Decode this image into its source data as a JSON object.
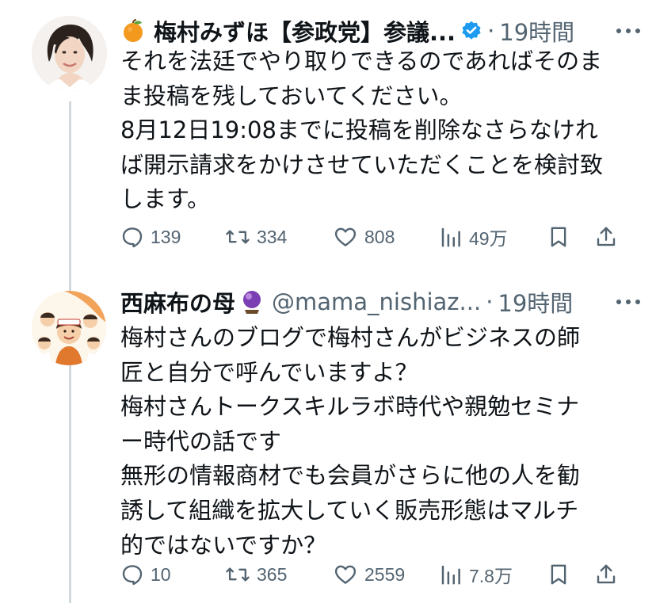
{
  "tweets": [
    {
      "display_name": "梅村みずほ【参政党】参議...",
      "handle": "",
      "time": "19時間",
      "lines": [
        "それを法廷でやり取りできるのであればそのま",
        "ま投稿を残しておいてください。",
        "8月12日19:08までに投稿を削除なさらなけれ",
        "ば開示請求をかけさせていただくことを検討致",
        "します。"
      ],
      "replies": "139",
      "reposts": "334",
      "likes": "808",
      "views": "49万"
    },
    {
      "display_name": "西麻布の母",
      "handle": "@mama_nishiaz...",
      "time": "19時間",
      "lines": [
        "梅村さんのブログで梅村さんがビジネスの師",
        "匠と自分で呼んでいますよ？",
        "梅村さんトークスキルラボ時代や親勉セミナ",
        "ー時代の話です",
        "無形の情報商材でも会員がさらに他の人を勧",
        "誘して組織を拡大していく販売形態はマルチ",
        "的ではないですか？"
      ],
      "replies": "10",
      "reposts": "365",
      "likes": "2559",
      "views": "7.8万"
    }
  ],
  "colors": {
    "verified": "#1d9bf0",
    "secondary_text": "#536471",
    "thread_line": "#cfd9de"
  },
  "icons": [
    "orange-emoji-icon",
    "verified-badge-icon",
    "crystal-ball-emoji-icon",
    "more-icon",
    "reply-icon",
    "repost-icon",
    "like-icon",
    "views-icon",
    "bookmark-icon",
    "share-icon"
  ]
}
